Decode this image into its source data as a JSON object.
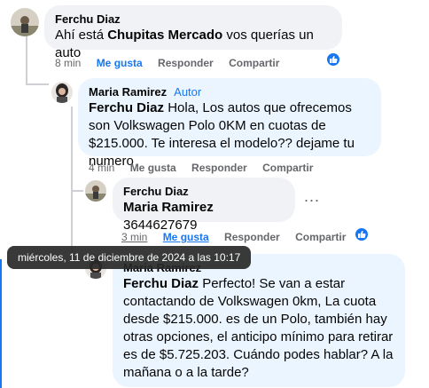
{
  "comments": [
    {
      "author": "Ferchu Diaz",
      "text_prefix": "Ahí está ",
      "mention": "Chupitas Mercado",
      "text_suffix": " vos querías un auto",
      "time": "8 min",
      "like": "Me gusta",
      "reply": "Responder",
      "share": "Compartir"
    },
    {
      "author": "Maria Ramirez",
      "role": "Autor",
      "mention": "Ferchu Diaz",
      "text": " Hola, Los autos que ofrecemos son Volkswagen Polo 0KM en cuotas de $215.000. Te interesa el modelo?? dejame tu numero",
      "time": "4 min",
      "like": "Me gusta",
      "reply": "Responder",
      "share": "Compartir"
    },
    {
      "author": "Ferchu Diaz",
      "mention": "Maria Ramirez",
      "text": " 3644627679",
      "time": "3 min",
      "like": "Me gusta",
      "reply": "Responder",
      "share": "Compartir"
    },
    {
      "author": "Maria Ramirez",
      "mention": "Ferchu Diaz",
      "text": " Perfecto! Se van a estar contactando de Volkswagen 0km, La cuota desde $215.000. es de un Polo, también hay otras opciones, el anticipo mínimo para retirar es de $5.725.203. Cuándo podes hablar? A la mañana o a la tarde?"
    }
  ],
  "tooltip": "miércoles, 11 de diciembre de 2024 a las 10:17",
  "more_dots": "...",
  "colors": {
    "accent": "#1877f2",
    "bubble": "#f0f2f5",
    "bubble_highlight": "#ebf5ff",
    "meta": "#65676b"
  },
  "icons": [
    "like-icon",
    "avatar",
    "more-options-icon"
  ]
}
